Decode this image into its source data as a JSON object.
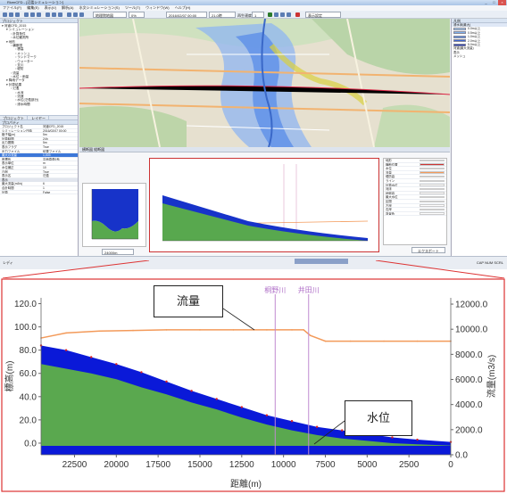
{
  "window": {
    "title": "RiverCFD - [氾濫シミュレーション]",
    "buttons": [
      "_",
      "□",
      "×"
    ]
  },
  "menu": [
    "ファイル(F)",
    "編集(E)",
    "表示(V)",
    "解析(A)",
    "水文シミュレーション(S)",
    "ツール(T)",
    "ウィンドウ(W)",
    "ヘルプ(H)"
  ],
  "toolbar": {
    "basemap_label": "地理院地図",
    "opacity_value": "0%",
    "datetime_value": "2016/02/07 00:00",
    "time_value": "21.0時",
    "speed_label": "再生速度",
    "speed_value": "1",
    "right_label": "表示設定"
  },
  "project_panel": {
    "header": "プロジェクト",
    "tree": [
      "河道CFD_2015",
      "シミュレーション",
      "計算条件",
      "水位観測所",
      "地形",
      "横断図",
      "標高",
      "メッシュ",
      "ランドマーク",
      "ウォーター",
      "支川",
      "堤防",
      "流量",
      "水位・雨量",
      "降雨データ",
      "計算結果",
      "氾濫",
      "水深",
      "流速",
      "水位(氾濫部分)",
      "浸水時間"
    ],
    "tabs": [
      "プロジェクト",
      "レイヤー"
    ]
  },
  "properties": {
    "header": "プロパティ",
    "rows": [
      {
        "k": "プロジェクト名",
        "v": "河道CFD_2015"
      },
      {
        "k": "シミュレーション日時",
        "v": "2016/02/07 00:00"
      },
      {
        "k": "格子幅(m)",
        "v": "5m"
      },
      {
        "k": "計算時間",
        "v": "24h"
      },
      {
        "k": "出力間隔",
        "v": "5m"
      },
      {
        "k": "表示フラグ",
        "v": "True"
      },
      {
        "k": "出力ファイル",
        "v": "結果ファイル"
      },
      {
        "k": "最大の流量",
        "v": "1,003"
      },
      {
        "k": "座標系",
        "v": "平面直角9系"
      },
      {
        "k": "表示単位",
        "v": "m"
      },
      {
        "k": "水位補正",
        "v": "10"
      },
      {
        "k": "凡例",
        "v": "True"
      },
      {
        "k": "表示名",
        "v": "氾濫"
      }
    ],
    "section": "表示",
    "rows2": [
      {
        "k": "最大流量(m3/s)",
        "v": "6"
      },
      {
        "k": "合計時間",
        "v": "1"
      },
      {
        "k": "計算",
        "v": "False"
      }
    ]
  },
  "legend_panel": {
    "header": "凡例",
    "title": "浸水深(最大)",
    "items": [
      {
        "label": "0.0m以上",
        "color": "#a9d3f5"
      },
      {
        "label": "0.5m以上",
        "color": "#7fb3f0"
      },
      {
        "label": "1.0m以上",
        "color": "#5a8fe6"
      },
      {
        "label": "2.0m以上",
        "color": "#3e66d4"
      },
      {
        "label": "5.0m以上",
        "color": "#2a3fb5"
      }
    ],
    "extra": [
      "河道(最大流量)",
      "表示",
      "メッシュ"
    ]
  },
  "bottom": {
    "tab_label": "横断図 縦断図",
    "inset_distance": "24000m",
    "status_left": "レディ",
    "status_right": "CAP NUM SCRL"
  },
  "side_list": {
    "items": [
      "地形",
      "横断位置",
      "水位",
      "流量",
      "堤防高",
      "ライン",
      "計算水位",
      "河床",
      "地盤高",
      "最大水位",
      "区間",
      "左岸",
      "右岸",
      "背景色"
    ],
    "color_label": "線色",
    "button": "エクスポート"
  },
  "zoom_chart": {
    "ylabel_left": "標高(m)",
    "ylabel_right": "流量(m3/s)",
    "xlabel": "距離(m)",
    "annotation_flow": "流量",
    "annotation_level": "水位",
    "rivers": [
      {
        "name": "桐野川",
        "x": 10500
      },
      {
        "name": "井田川",
        "x": 8500
      }
    ]
  },
  "chart_data": {
    "type": "area",
    "x_ticks": [
      22500,
      20000,
      17500,
      15000,
      12500,
      10000,
      7500,
      5000,
      2500,
      0
    ],
    "y_left_ticks": [
      "0.0",
      "20.0",
      "40.0",
      "60.0",
      "80.0",
      "100.0",
      "120.0"
    ],
    "y_right_ticks": [
      "0.0",
      "2000.0",
      "4000.0",
      "6000.0",
      "8000.0",
      "10000.0",
      "12000.0"
    ],
    "xlim": [
      24500,
      0
    ],
    "ylim_left": [
      -10,
      125
    ],
    "ylim_right": [
      0,
      12500
    ],
    "series": [
      {
        "name": "流量",
        "axis": "right",
        "color": "#f39a5a",
        "x": [
          24500,
          23000,
          21000,
          19000,
          17000,
          15000,
          13000,
          11000,
          9500,
          8800,
          8400,
          7500,
          6000,
          4000,
          2000,
          0
        ],
        "y": [
          9300,
          9700,
          9850,
          9900,
          9950,
          9950,
          9950,
          9950,
          9950,
          9950,
          9500,
          9050,
          9050,
          9050,
          9050,
          9050
        ]
      },
      {
        "name": "水位",
        "axis": "left",
        "color": "#0a19d8",
        "x": [
          24500,
          23000,
          21500,
          20000,
          18500,
          17000,
          15500,
          14000,
          12500,
          11000,
          9500,
          8000,
          6500,
          5000,
          3500,
          2000,
          0
        ],
        "y": [
          84,
          80,
          74,
          68,
          61,
          53,
          45,
          38,
          31,
          24,
          19,
          14,
          11,
          8,
          5,
          3,
          1
        ]
      },
      {
        "name": "地盤",
        "axis": "left",
        "color": "#5aa84f",
        "x": [
          24500,
          23000,
          21500,
          20000,
          18500,
          17000,
          15500,
          14000,
          12500,
          11000,
          9500,
          8000,
          6500,
          5000,
          3500,
          2000,
          0
        ],
        "y": [
          68,
          64,
          60,
          55,
          48,
          42,
          35,
          29,
          22,
          16,
          11,
          7,
          4,
          2,
          0,
          -1,
          -2
        ]
      }
    ]
  }
}
